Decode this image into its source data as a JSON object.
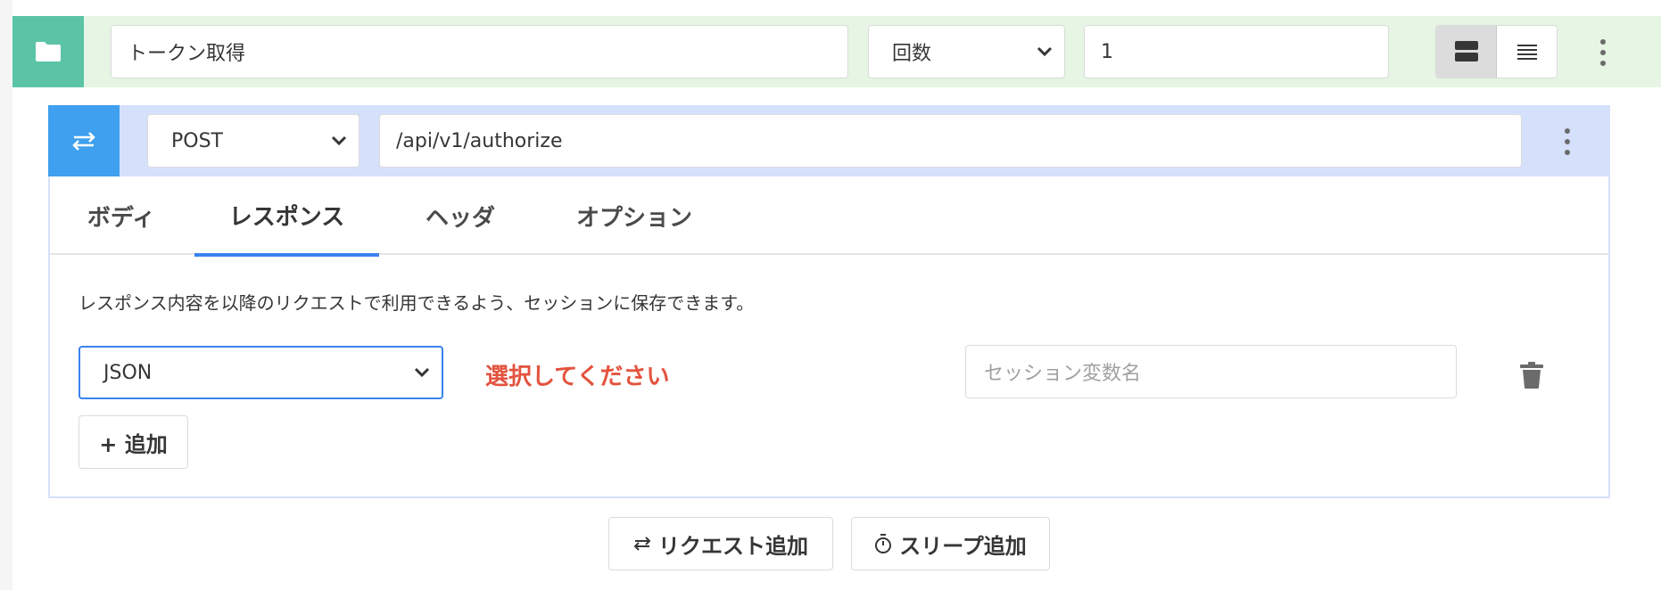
{
  "folder": {
    "icon": "folder-icon",
    "name_value": "トークン取得",
    "loop_type": "回数",
    "loop_count": "1",
    "view_modes": [
      "card-view-icon",
      "list-view-icon"
    ],
    "menu_icon": "kebab-menu-icon"
  },
  "request": {
    "icon": "swap-arrows-icon",
    "method": "POST",
    "url": "/api/v1/authorize",
    "menu_icon": "kebab-menu-icon",
    "tabs": [
      {
        "label": "ボディ",
        "active": false
      },
      {
        "label": "レスポンス",
        "active": true
      },
      {
        "label": "ヘッダ",
        "active": false
      },
      {
        "label": "オプション",
        "active": false
      }
    ],
    "response": {
      "description": "レスポンス内容を以降のリクエストで利用できるよう、セッションに保存できます。",
      "format": "JSON",
      "warning": "選択してください",
      "session_placeholder": "セッション変数名",
      "add_label": "+ 追加"
    }
  },
  "actions": {
    "add_request_label": "リクエスト追加",
    "add_sleep_label": "スリープ追加"
  },
  "colors": {
    "folder_accent": "#5bc4a6",
    "folder_bg": "#e6f5e4",
    "request_accent": "#3ea0ee",
    "request_bg": "#d5e1fb",
    "active_tab": "#3b82f0",
    "warning": "#e3533e"
  }
}
